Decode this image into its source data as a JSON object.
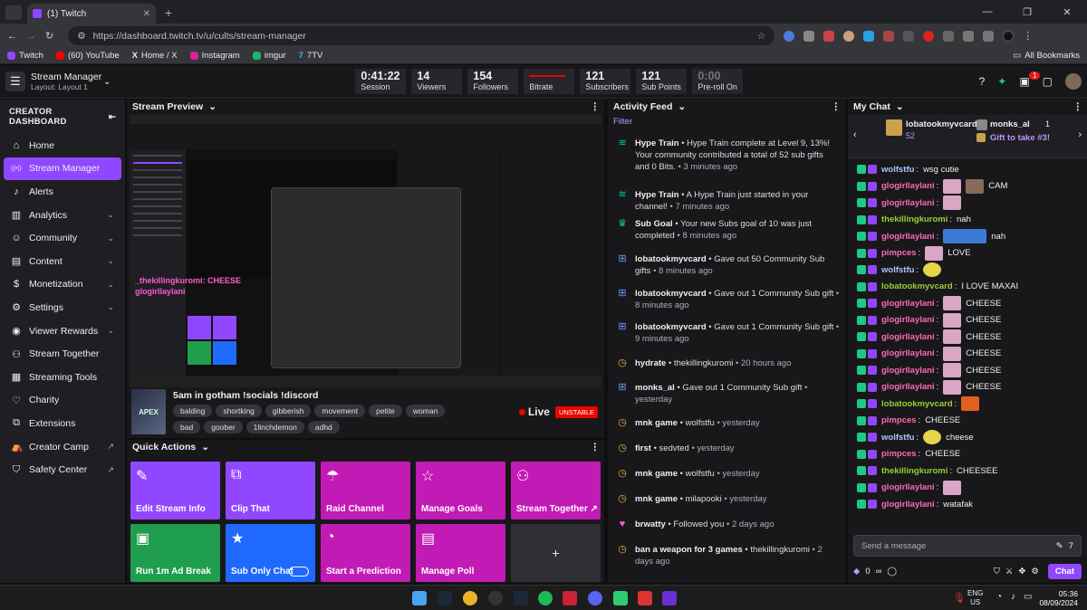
{
  "browser": {
    "tab_title": "(1) Twitch",
    "url": "https://dashboard.twitch.tv/u/cults/stream-manager",
    "bookmarks": [
      "Twitch",
      "(60) YouTube",
      "Home / X",
      "Instagram",
      "imgur",
      "7TV"
    ],
    "all_bookmarks": "All Bookmarks"
  },
  "topnav": {
    "title": "Stream Manager",
    "layout": "Layout: Layout 1",
    "stats": [
      {
        "value": "0:41:22",
        "label": "Session"
      },
      {
        "value": "14",
        "label": "Viewers"
      },
      {
        "value": "154",
        "label": "Followers"
      },
      {
        "value": "",
        "label": "Bitrate"
      },
      {
        "value": "121",
        "label": "Subscribers"
      },
      {
        "value": "121",
        "label": "Sub Points"
      },
      {
        "value": "0:00",
        "label": "Pre-roll On"
      }
    ],
    "notification_count": "1"
  },
  "sidebar": {
    "header": "CREATOR DASHBOARD",
    "items": [
      {
        "label": "Home",
        "icon": "home-icon"
      },
      {
        "label": "Stream Manager",
        "icon": "broadcast-icon"
      },
      {
        "label": "Alerts",
        "icon": "bell-icon"
      },
      {
        "label": "Analytics",
        "icon": "chart-icon"
      },
      {
        "label": "Community",
        "icon": "people-icon"
      },
      {
        "label": "Content",
        "icon": "content-icon"
      },
      {
        "label": "Monetization",
        "icon": "dollar-icon"
      },
      {
        "label": "Settings",
        "icon": "gear-icon"
      },
      {
        "label": "Viewer Rewards",
        "icon": "reward-icon"
      },
      {
        "label": "Stream Together",
        "icon": "add-person-icon"
      },
      {
        "label": "Streaming Tools",
        "icon": "tools-icon"
      },
      {
        "label": "Charity",
        "icon": "heart-icon"
      },
      {
        "label": "Extensions",
        "icon": "puzzle-icon"
      },
      {
        "label": "Creator Camp",
        "icon": "camp-icon"
      },
      {
        "label": "Safety Center",
        "icon": "shield-icon"
      }
    ]
  },
  "preview": {
    "header": "Stream Preview",
    "stream_title": "5am in gotham !socials !discord",
    "game": "APEX",
    "tags": [
      "balding",
      "shortking",
      "gibberish",
      "movement",
      "petite",
      "woman",
      "bad",
      "goober",
      "1linchdemon",
      "adhd"
    ],
    "live": "Live",
    "status": "UNSTABLE",
    "overlay_chat": [
      "_thekillingkuromi: CHEESE",
      "glogirllaylani"
    ]
  },
  "quick_actions": {
    "header": "Quick Actions",
    "buttons": [
      {
        "label": "Edit Stream Info",
        "color": "#9147ff",
        "icon": "pencil-icon"
      },
      {
        "label": "Clip That",
        "color": "#9147ff",
        "icon": "clip-icon"
      },
      {
        "label": "Raid Channel",
        "color": "#c21bb5",
        "icon": "raid-icon"
      },
      {
        "label": "Manage Goals",
        "color": "#c21bb5",
        "icon": "star-outline-icon"
      },
      {
        "label": "Stream Together ↗",
        "color": "#c21bb5",
        "icon": "add-person-icon"
      },
      {
        "label": "Run 1m Ad Break",
        "color": "#1f9e4d",
        "icon": "ad-icon"
      },
      {
        "label": "Sub Only Chat",
        "color": "#1f69ff",
        "icon": "star-icon"
      },
      {
        "label": "Start a Prediction",
        "color": "#c21bb5",
        "icon": "prediction-icon"
      },
      {
        "label": "Manage Poll",
        "color": "#c21bb5",
        "icon": "poll-icon"
      },
      {
        "label": "+",
        "color": "#2f2f35",
        "icon": "plus-icon"
      }
    ]
  },
  "activity": {
    "header": "Activity Feed",
    "filter": "Filter",
    "items": [
      {
        "icon": "hype-icon",
        "title": "Hype Train",
        "text": " • Hype Train complete at Level 9, 13%! Your community contributed a total of 52 sub gifts and 0 Bits.",
        "time": " • 3 minutes ago"
      },
      {
        "icon": "hype-icon",
        "title": "Hype Train",
        "text": " • A Hype Train just started in your channel!",
        "time": " • 7 minutes ago"
      },
      {
        "icon": "trophy-icon",
        "title": "Sub Goal",
        "text": " • Your new Subs goal of 10 was just completed",
        "time": " • 8 minutes ago"
      },
      {
        "icon": "gift-icon",
        "title": "lobatookmyvcard",
        "text": " • Gave out 50 Community Sub gifts",
        "time": " • 8 minutes ago"
      },
      {
        "icon": "gift-icon",
        "title": "lobatookmyvcard",
        "text": " • Gave out 1 Community Sub gift",
        "time": " • 8 minutes ago"
      },
      {
        "icon": "gift-icon",
        "title": "lobatookmyvcard",
        "text": " • Gave out 1 Community Sub gift",
        "time": " • 9 minutes ago"
      },
      {
        "icon": "raid-icon",
        "title": "hydrate",
        "text": " • thekillingkuromi",
        "time": " • 20 hours ago"
      },
      {
        "icon": "gift-icon",
        "title": "monks_al",
        "text": " • Gave out 1 Community Sub gift",
        "time": " • yesterday"
      },
      {
        "icon": "raid-icon",
        "title": "mnk game",
        "text": " • wolfstfu",
        "time": " • yesterday"
      },
      {
        "icon": "raid-icon",
        "title": "first",
        "text": " • sedvted",
        "time": " • yesterday"
      },
      {
        "icon": "raid-icon",
        "title": "mnk game",
        "text": " • wolfstfu",
        "time": " • yesterday"
      },
      {
        "icon": "raid-icon",
        "title": "mnk game",
        "text": " • milapooki",
        "time": " • yesterday"
      },
      {
        "icon": "heart-icon",
        "title": "brwatty",
        "text": " • Followed you",
        "time": " • 2 days ago"
      },
      {
        "icon": "raid-icon",
        "title": "ban a weapon for 3 games",
        "text": " • thekillingkuromi",
        "time": " • 2 days ago"
      }
    ]
  },
  "chat": {
    "header": "My Chat",
    "top_gifter": "lobatookmyvcard",
    "top_gifter_count": "52",
    "gifter2": "monks_al",
    "gifter2_count": "1",
    "gift_cta": "Gift to take #3!",
    "messages": [
      {
        "user": "wolfstfu",
        "color": "#adc3ff",
        "text": "wsg cutie",
        "emote": ""
      },
      {
        "user": "glogirllaylani",
        "color": "#ff69b4",
        "text": "",
        "emote": "face"
      },
      {
        "user": "glogirllaylani",
        "color": "#ff69b4",
        "text": "",
        "emote": "face"
      },
      {
        "user": "thekillingkuromi",
        "color": "#9acd32",
        "text": "nah",
        "emote": ""
      },
      {
        "user": "glogirllaylani",
        "color": "#ff69b4",
        "text": "nah",
        "emote": "car"
      },
      {
        "user": "pimpces",
        "color": "#ff69b4",
        "text": "LOVE",
        "emote": "face"
      },
      {
        "user": "wolfstfu",
        "color": "#adc3ff",
        "text": "",
        "emote": "smile"
      },
      {
        "user": "lobatookmyvcard",
        "color": "#9acd32",
        "text": "I LOVE MAXAI",
        "emote": ""
      },
      {
        "user": "glogirllaylani",
        "color": "#ff69b4",
        "text": "CHEESE",
        "emote": "face"
      },
      {
        "user": "glogirllaylani",
        "color": "#ff69b4",
        "text": "CHEESE",
        "emote": "face"
      },
      {
        "user": "glogirllaylani",
        "color": "#ff69b4",
        "text": "CHEESE",
        "emote": "face"
      },
      {
        "user": "glogirllaylani",
        "color": "#ff69b4",
        "text": "CHEESE",
        "emote": "face"
      },
      {
        "user": "glogirllaylani",
        "color": "#ff69b4",
        "text": "CHEESE",
        "emote": "face"
      },
      {
        "user": "glogirllaylani",
        "color": "#ff69b4",
        "text": "CHEESE",
        "emote": "face"
      },
      {
        "user": "lobatookmyvcard",
        "color": "#9acd32",
        "text": "",
        "emote": "fire"
      },
      {
        "user": "pimpces",
        "color": "#ff69b4",
        "text": "CHEESE",
        "emote": ""
      },
      {
        "user": "wolfstfu",
        "color": "#adc3ff",
        "text": "cheese",
        "emote": "smile"
      },
      {
        "user": "pimpces",
        "color": "#ff69b4",
        "text": "CHEESE",
        "emote": ""
      },
      {
        "user": "thekillingkuromi",
        "color": "#9acd32",
        "text": "CHEESEE",
        "emote": ""
      },
      {
        "user": "glogirllaylani",
        "color": "#ff69b4",
        "text": "",
        "emote": "face"
      },
      {
        "user": "glogirllaylani",
        "color": "#ff69b4",
        "text": "watafak",
        "emote": ""
      }
    ],
    "cam_text": "CAM",
    "input_placeholder": "Send a message",
    "points": "0",
    "chat_button": "Chat"
  },
  "taskbar": {
    "lang1": "ENG",
    "lang2": "US",
    "time": "05:36",
    "date": "08/09/2024"
  }
}
